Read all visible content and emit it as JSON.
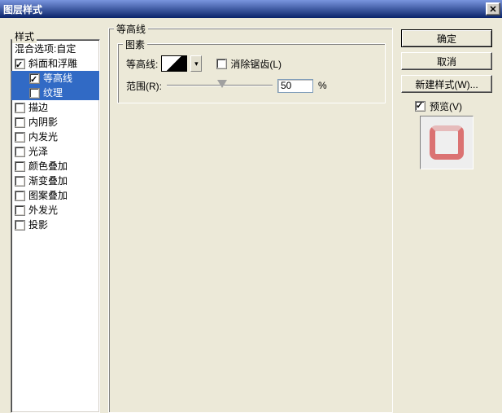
{
  "title": "图层样式",
  "stylesHeader": "样式",
  "styleItems": [
    {
      "label": "混合选项:自定",
      "hasCheckbox": false,
      "checked": false,
      "selected": false,
      "indent": false
    },
    {
      "label": "斜面和浮雕",
      "hasCheckbox": true,
      "checked": true,
      "selected": false,
      "indent": false
    },
    {
      "label": "等高线",
      "hasCheckbox": true,
      "checked": true,
      "selected": true,
      "indent": true
    },
    {
      "label": "纹理",
      "hasCheckbox": true,
      "checked": false,
      "selected": true,
      "indent": true
    },
    {
      "label": "描边",
      "hasCheckbox": true,
      "checked": false,
      "selected": false,
      "indent": false
    },
    {
      "label": "内阴影",
      "hasCheckbox": true,
      "checked": false,
      "selected": false,
      "indent": false
    },
    {
      "label": "内发光",
      "hasCheckbox": true,
      "checked": false,
      "selected": false,
      "indent": false
    },
    {
      "label": "光泽",
      "hasCheckbox": true,
      "checked": false,
      "selected": false,
      "indent": false
    },
    {
      "label": "颜色叠加",
      "hasCheckbox": true,
      "checked": false,
      "selected": false,
      "indent": false
    },
    {
      "label": "渐变叠加",
      "hasCheckbox": true,
      "checked": false,
      "selected": false,
      "indent": false
    },
    {
      "label": "图案叠加",
      "hasCheckbox": true,
      "checked": false,
      "selected": false,
      "indent": false
    },
    {
      "label": "外发光",
      "hasCheckbox": true,
      "checked": false,
      "selected": false,
      "indent": false
    },
    {
      "label": "投影",
      "hasCheckbox": true,
      "checked": false,
      "selected": false,
      "indent": false
    }
  ],
  "outerGroup": "等高线",
  "innerGroup": "图素",
  "contourLabel": "等高线:",
  "antiAliasLabel": "消除锯齿(L)",
  "rangeLabel": "范围(R):",
  "rangeValue": "50",
  "percentSymbol": "%",
  "buttons": {
    "ok": "确定",
    "cancel": "取消",
    "newStyle": "新建样式(W)..."
  },
  "previewLabel": "预览(V)",
  "previewChecked": true
}
